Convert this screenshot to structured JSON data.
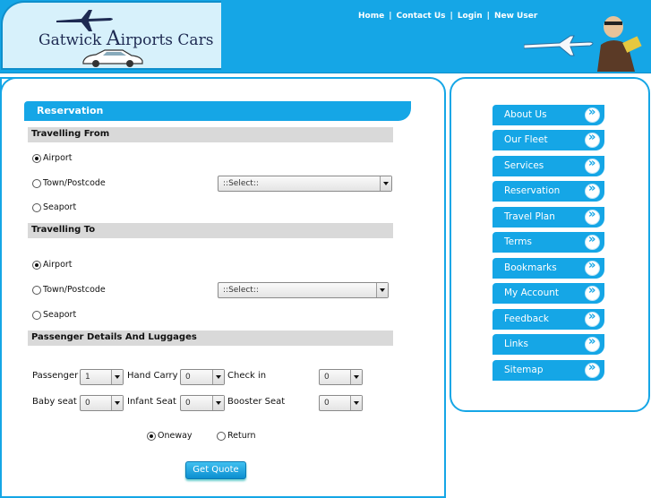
{
  "brand": {
    "logo_part1": "Gatwick ",
    "logo_a": "A",
    "logo_part2": "irports Cars"
  },
  "top_nav": [
    "Home",
    "Contact Us",
    "Login",
    "New User"
  ],
  "reservation": {
    "title": "Reservation",
    "travelling_from": {
      "heading": "Travelling From",
      "options": [
        "Airport",
        "Town/Postcode",
        "Seaport"
      ],
      "selected": "Airport",
      "select_value": "::Select::"
    },
    "travelling_to": {
      "heading": "Travelling To",
      "options": [
        "Airport",
        "Town/Postcode",
        "Seaport"
      ],
      "selected": "Airport",
      "select_value": "::Select::"
    },
    "passenger": {
      "heading": "Passenger Details And Luggages",
      "passenger_label": "Passenger",
      "passenger_value": "1",
      "hand_carry_label": "Hand Carry",
      "hand_carry_value": "0",
      "check_in_label": "Check in",
      "check_in_value": "0",
      "baby_seat_label": "Baby seat",
      "baby_seat_value": "0",
      "infant_seat_label": "Infant Seat",
      "infant_seat_value": "0",
      "booster_seat_label": "Booster Seat",
      "booster_seat_value": "0"
    },
    "trip": {
      "oneway": "Oneway",
      "return": "Return",
      "selected": "Oneway"
    },
    "submit_label": "Get Quote"
  },
  "sidebar": {
    "items": [
      "About Us",
      "Our Fleet",
      "Services",
      "Reservation",
      "Travel Plan",
      "Terms",
      "Bookmarks",
      "My Account",
      "Feedback",
      "Links",
      "Sitemap"
    ]
  },
  "colors": {
    "accent": "#15a6e6",
    "section_bar": "#d9d9d9",
    "logo_bg": "#d7f1fb"
  }
}
